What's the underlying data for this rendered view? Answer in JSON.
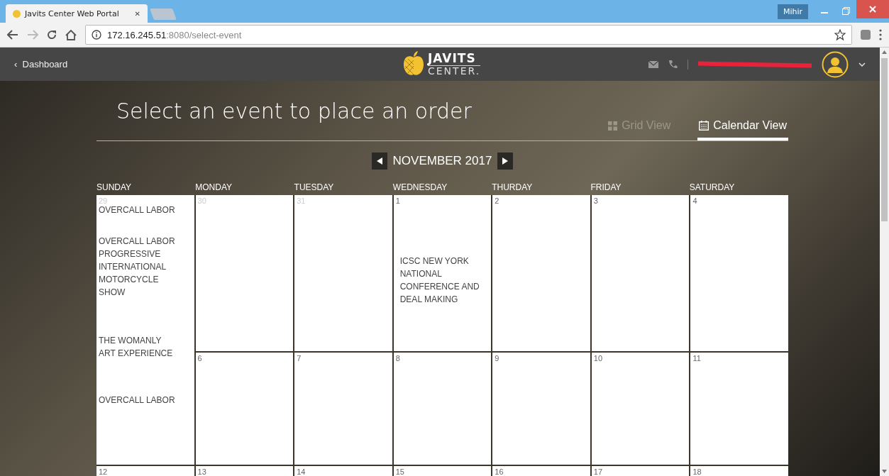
{
  "browser": {
    "tab_title": "Javits Center Web Portal",
    "tab_close": "✕",
    "url_host": "172.16.245.51",
    "url_path": ":8080/select-event",
    "profile": "Mihir"
  },
  "header": {
    "back_label": "‹  Dashboard",
    "logo_top": "JAVITS",
    "logo_bottom": "CENTER."
  },
  "title": "Select an event to place an order",
  "views": [
    {
      "label": "Grid View",
      "selected": false,
      "kind": "grid"
    },
    {
      "label": "Calendar View",
      "selected": true,
      "kind": "calendar"
    }
  ],
  "month": "NOVEMBER 2017",
  "weekdays": [
    "SUNDAY",
    "MONDAY",
    "TUESDAY",
    "WEDNESDAY",
    "THURDAY",
    "FRIDAY",
    "SATURDAY"
  ],
  "weeks": [
    {
      "days": [
        {
          "day": "29",
          "other_month": true,
          "events": [
            "OVERCALL LABOR",
            "OVERCALL LABOR",
            "PROGRESSIVE INTERNATIONAL MOTORCYCLE SHOW",
            "THE WOMANLY ART EXPERIENCE",
            "OVERCALL LABOR"
          ]
        },
        {
          "day": "30",
          "other_month": true
        },
        {
          "day": "31",
          "other_month": true
        },
        {
          "day": "1",
          "other_month": false,
          "events": [
            "ICSC NEW YORK NATIONAL CONFERENCE AND DEAL MAKING"
          ]
        },
        {
          "day": "2",
          "other_month": false
        },
        {
          "day": "3",
          "other_month": false
        },
        {
          "day": "4",
          "other_month": false
        }
      ]
    },
    {
      "days": [
        {
          "day": "6",
          "other_month": false
        },
        {
          "day": "7",
          "other_month": false
        },
        {
          "day": "8",
          "other_month": false
        },
        {
          "day": "9",
          "other_month": false
        },
        {
          "day": "10",
          "other_month": false
        },
        {
          "day": "11",
          "other_month": false
        }
      ]
    },
    {
      "days": [
        {
          "day": "12",
          "other_month": false
        },
        {
          "day": "13",
          "other_month": false
        },
        {
          "day": "14",
          "other_month": false
        },
        {
          "day": "15",
          "other_month": false
        },
        {
          "day": "16",
          "other_month": false
        },
        {
          "day": "17",
          "other_month": false
        },
        {
          "day": "18",
          "other_month": false
        }
      ]
    }
  ]
}
